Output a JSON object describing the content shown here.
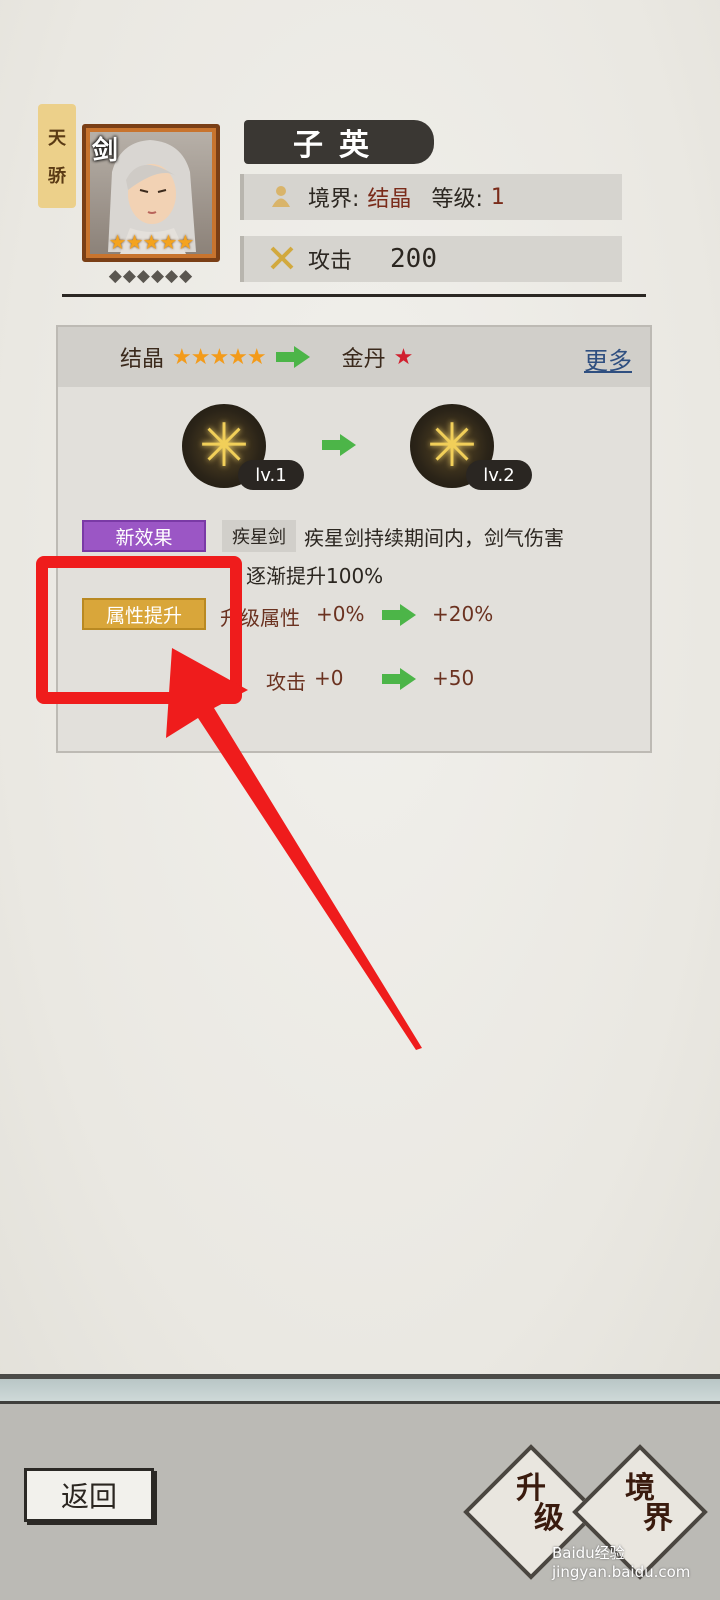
{
  "hero": {
    "rank_tag": [
      "天",
      "骄"
    ],
    "class_char": "剑",
    "stars": "★★★★★",
    "diamonds": "◆◆◆◆◆◆",
    "name": "子英",
    "realm_label": "境界:",
    "realm_value": "结晶",
    "level_label": "等级:",
    "level_value": "1",
    "attack_label": "攻击",
    "attack_value": "200"
  },
  "breakthrough": {
    "from_realm": "结晶",
    "from_stars": "★★★★★",
    "to_realm": "金丹",
    "to_star": "★",
    "more_label": "更多",
    "skill_from_level": "lv.1",
    "skill_to_level": "lv.2",
    "new_effect_badge": "新效果",
    "skill_name": "疾星剑",
    "effect_line1": "疾星剑持续期间内，剑气伤害",
    "effect_line2": "逐渐提升100%",
    "attr_badge": "属性提升",
    "attr_name": "升级属性",
    "attr_from": "+0%",
    "attr_to": "+20%",
    "atk_name": "攻击",
    "atk_from": "+0",
    "atk_to": "+50"
  },
  "bottom": {
    "back_label": "返回",
    "upgrade_label": [
      "升",
      "级"
    ],
    "realm_label": [
      "境",
      "界"
    ],
    "watermark": "Baidu经验 jingyan.baidu.com"
  },
  "colors": {
    "annotation_red": "#ef1c1c",
    "new_effect_purple": "#9b56c5",
    "attr_gold": "#d9a63a",
    "arrow_green": "#4cb548"
  }
}
